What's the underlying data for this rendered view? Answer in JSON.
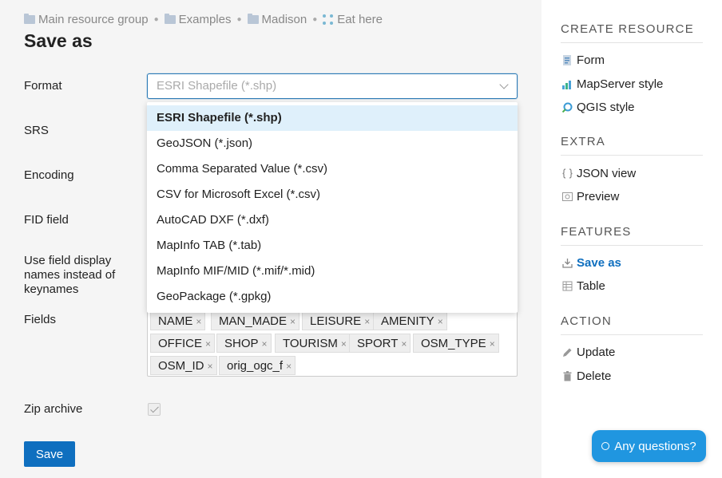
{
  "breadcrumb": {
    "items": [
      "Main resource group",
      "Examples",
      "Madison",
      "Eat here"
    ]
  },
  "page": {
    "title": "Save as"
  },
  "form": {
    "format_label": "Format",
    "format_placeholder": "ESRI Shapefile (*.shp)",
    "srs_label": "SRS",
    "encoding_label": "Encoding",
    "fid_label": "FID field",
    "display_names_label": "Use field display names instead of keynames",
    "fields_label": "Fields",
    "zip_label": "Zip archive",
    "zip_checked": true,
    "save_label": "Save"
  },
  "dropdown": {
    "options": [
      "ESRI Shapefile (*.shp)",
      "GeoJSON (*.json)",
      "Comma Separated Value (*.csv)",
      "CSV for Microsoft Excel (*.csv)",
      "AutoCAD DXF (*.dxf)",
      "MapInfo TAB (*.tab)",
      "MapInfo MIF/MID (*.mif/*.mid)",
      "GeoPackage (*.gpkg)"
    ],
    "selected_index": 0
  },
  "fields": {
    "tags": [
      "NAME",
      "MAN_MADE",
      "LEISURE",
      "AMENITY",
      "OFFICE",
      "SHOP",
      "TOURISM",
      "SPORT",
      "OSM_TYPE",
      "OSM_ID",
      "orig_ogc_f"
    ],
    "remove_symbol": "×"
  },
  "sidebar": {
    "create": {
      "title": "CREATE RESOURCE",
      "items": [
        {
          "label": "Form",
          "icon": "form-icon"
        },
        {
          "label": "MapServer style",
          "icon": "mapserver-style-icon"
        },
        {
          "label": "QGIS style",
          "icon": "qgis-style-icon"
        }
      ]
    },
    "extra": {
      "title": "EXTRA",
      "items": [
        {
          "label": "JSON view",
          "icon": "braces-icon"
        },
        {
          "label": "Preview",
          "icon": "preview-icon"
        }
      ]
    },
    "features": {
      "title": "FEATURES",
      "items": [
        {
          "label": "Save as",
          "icon": "download-icon",
          "active": true
        },
        {
          "label": "Table",
          "icon": "table-icon"
        }
      ]
    },
    "action": {
      "title": "ACTION",
      "items": [
        {
          "label": "Update",
          "icon": "pencil-icon"
        },
        {
          "label": "Delete",
          "icon": "trash-icon"
        }
      ]
    }
  },
  "chat": {
    "label": "Any questions?"
  },
  "colors": {
    "accent": "#0f6fbf",
    "chat": "#2096e0",
    "selected_option_bg": "#dff0fb"
  }
}
